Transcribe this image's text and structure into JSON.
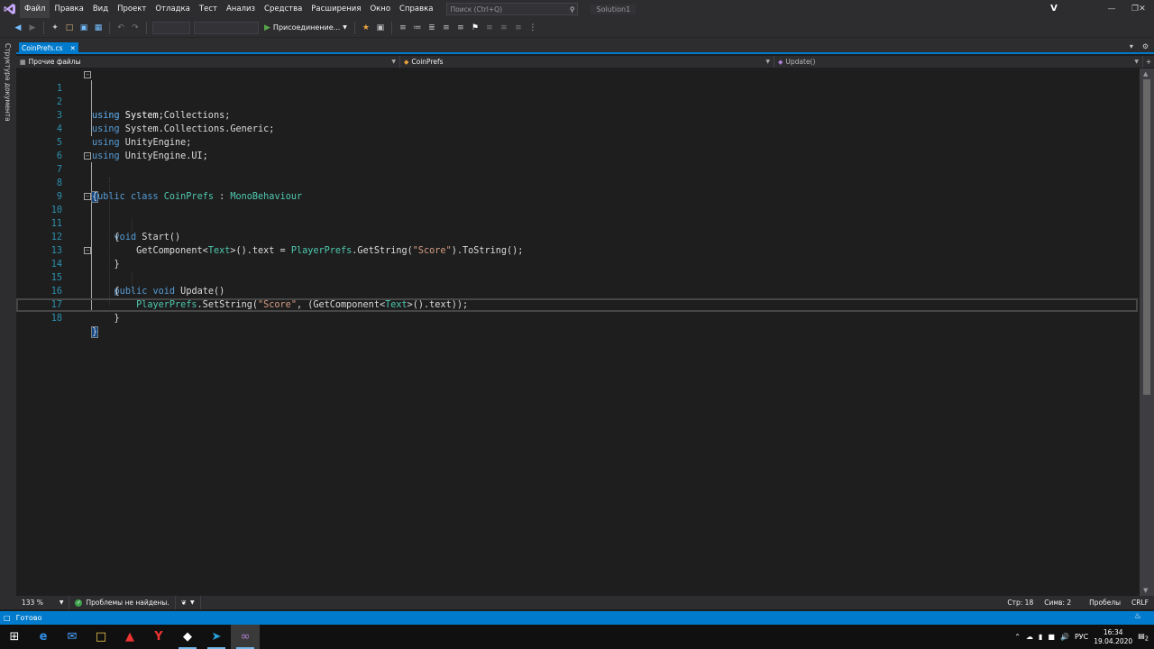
{
  "menubar": {
    "items": [
      "Файл",
      "Правка",
      "Вид",
      "Проект",
      "Отладка",
      "Тест",
      "Анализ",
      "Средства",
      "Расширения",
      "Окно",
      "Справка"
    ],
    "search_placeholder": "Поиск (Ctrl+Q)",
    "solution": "Solution1",
    "user_initial": "V"
  },
  "toolbar": {
    "attach_label": "Присоединение..."
  },
  "left_strip": {
    "label": "Структура документа"
  },
  "tab": {
    "filename": "CoinPrefs.cs",
    "close": "✕"
  },
  "navbar": {
    "project": "Прочие файлы",
    "class": "CoinPrefs",
    "member": "Update()"
  },
  "code": {
    "lines": [
      "1",
      "2",
      "3",
      "4",
      "5",
      "6",
      "7",
      "8",
      "9",
      "10",
      "11",
      "12",
      "13",
      "14",
      "15",
      "16",
      "17",
      "18"
    ]
  },
  "edstatus": {
    "zoom": "133 %",
    "problems": "Проблемы не найдены.",
    "line": "Стр: 18",
    "col": "Симв: 2",
    "spaces": "Пробелы",
    "eol": "CRLF"
  },
  "statusbar": {
    "ready": "Готово"
  },
  "taskbar": {
    "lang": "РУС",
    "time": "16:34",
    "date": "19.04.2020",
    "notifications": "2"
  },
  "colors": {
    "accent": "#007acc",
    "keyword": "#569cd6",
    "type": "#4ec9b0",
    "string": "#d69d85",
    "line_number": "#2b91af"
  }
}
